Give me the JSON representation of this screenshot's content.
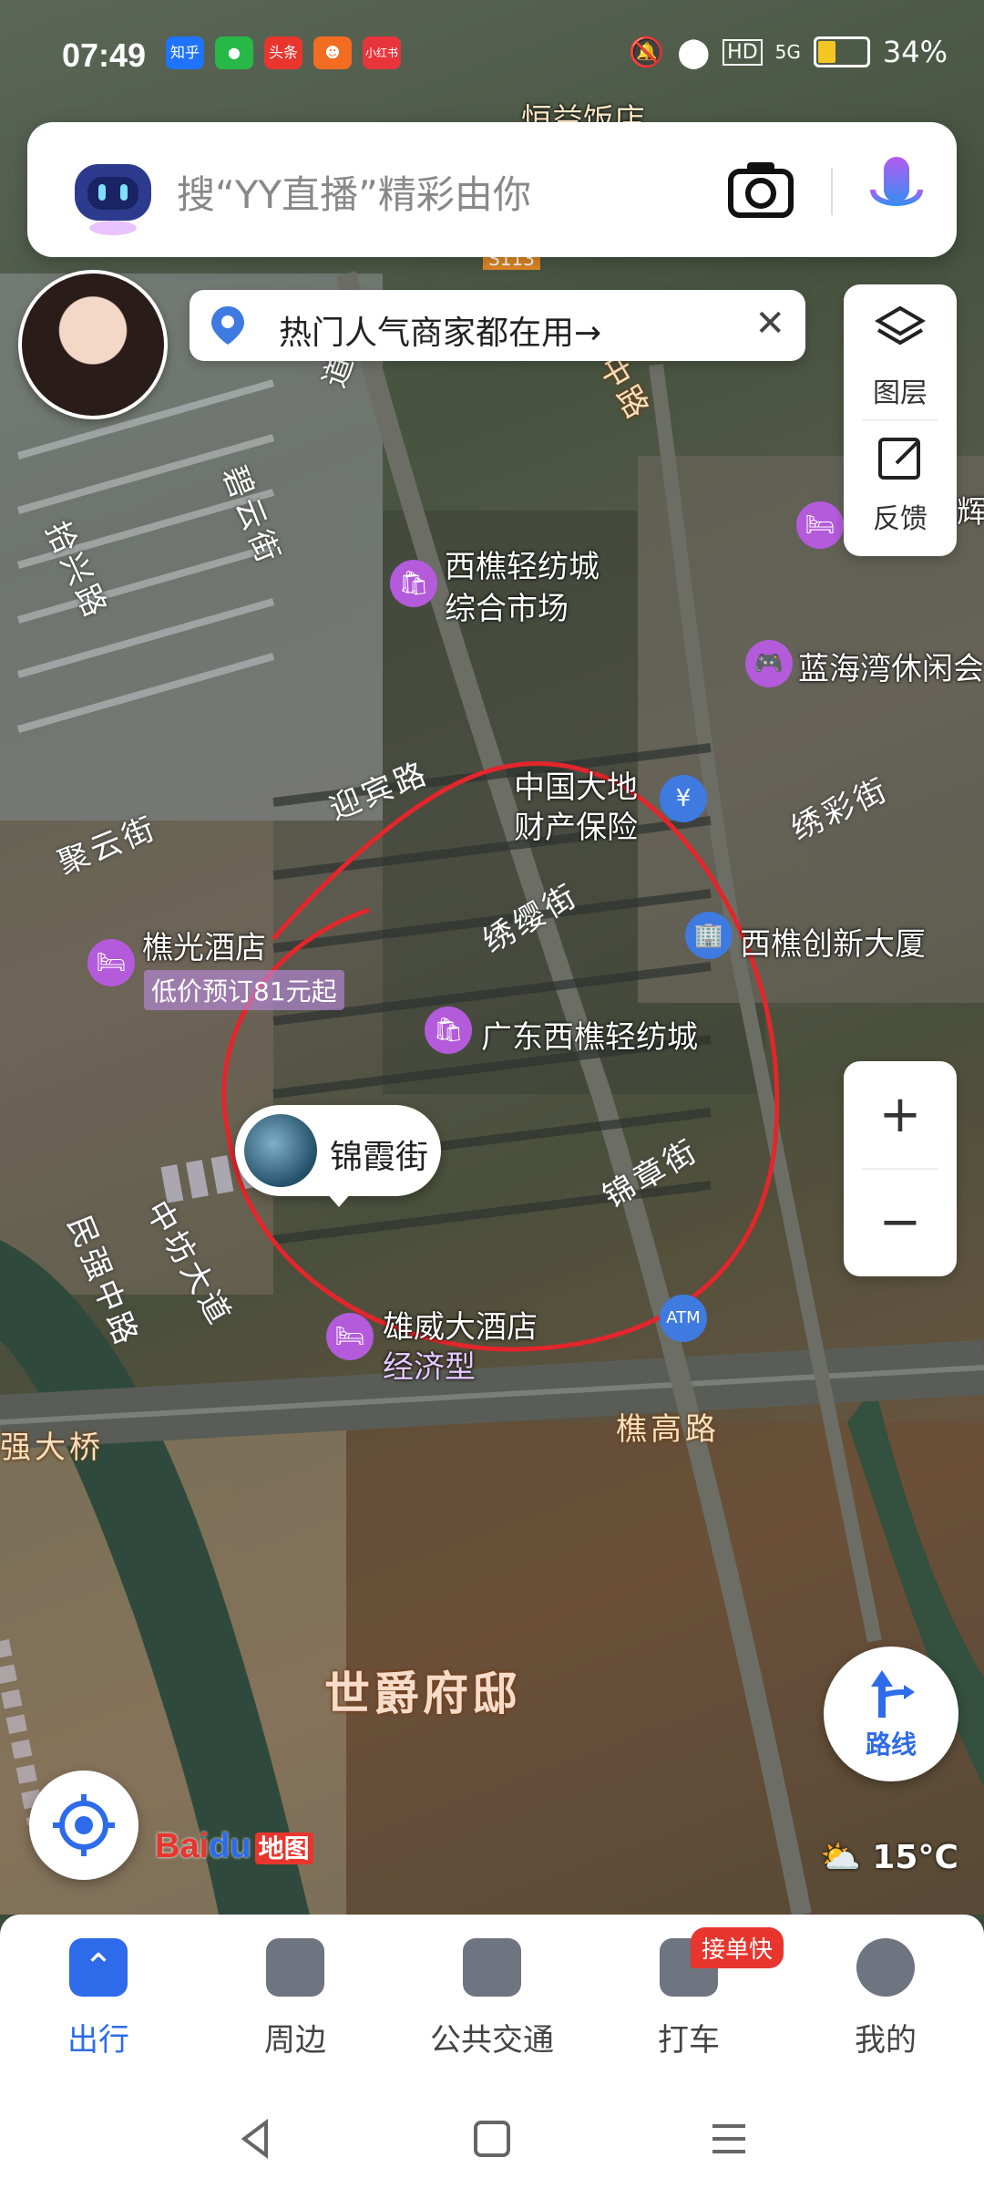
{
  "status_bar": {
    "time": "07:49",
    "apps": [
      {
        "label": "知乎",
        "color": "#1f74ff"
      },
      {
        "label": "●",
        "color": "#27b847"
      },
      {
        "label": "头条",
        "color": "#e8352e"
      },
      {
        "label": "☻",
        "color": "#f26d21"
      },
      {
        "label": "小红书",
        "color": "#e8353b"
      }
    ],
    "network": "5G",
    "hd": "HD",
    "battery_level": 0.34,
    "battery_text": "34%"
  },
  "search": {
    "placeholder": "搜“YY直播”精彩由你",
    "camera_icon": "camera-icon",
    "mic_icon": "microphone-icon"
  },
  "promo": {
    "text": "热门人气商家都在用→",
    "close": "✕"
  },
  "side_panel": {
    "layers_label": "图层",
    "feedback_label": "反馈"
  },
  "zoom": {
    "plus": "+",
    "minus": "−"
  },
  "map_labels": {
    "poi_top": "恒益饭店",
    "hotel_top_right": "辉",
    "market_1": "西樵轻纺城",
    "market_2": "综合市场",
    "leisure": "蓝海湾休闲会",
    "insurance_1": "中国大地",
    "insurance_2": "财产保险",
    "innovation": "西樵创新大厦",
    "hotel_left": "樵光酒店",
    "hotel_left_coupon": "低价预订81元起",
    "textile_city": "广东西樵轻纺城",
    "hotel_bottom": "雄威大酒店",
    "hotel_bottom_tag": "经济型",
    "district": "世爵府邸",
    "bridge": "桥",
    "bridge_left": "强大桥",
    "road_1": "迎宾路",
    "road_2": "碧云街",
    "road_3": "拾兴路",
    "road_4": "聚云街",
    "road_5": "绣缨街",
    "road_6": "绣彩街",
    "road_7": "锦章街",
    "road_8": "民强中路",
    "road_9": "中坊大道",
    "road_10": "樵高路",
    "road_11": "道",
    "road_12": "中路",
    "sign": "S113"
  },
  "callout": {
    "name": "锦霞街"
  },
  "route_button": {
    "label": "路线"
  },
  "brand": {
    "text_red": "Bai",
    "text_blue": "du",
    "suffix": "地图"
  },
  "weather": {
    "temp": "15°C"
  },
  "tabs": [
    {
      "label": "出行",
      "active": true
    },
    {
      "label": "周边",
      "active": false
    },
    {
      "label": "公共交通",
      "active": false
    },
    {
      "label": "打车",
      "active": false
    },
    {
      "label": "我的",
      "active": false
    }
  ],
  "hot_badge": "接单快"
}
